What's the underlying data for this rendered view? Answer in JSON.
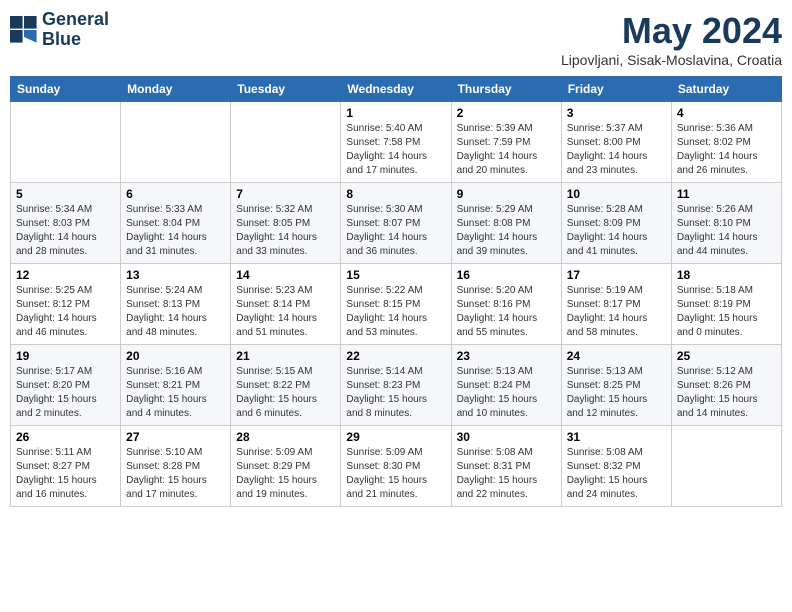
{
  "header": {
    "logo_line1": "General",
    "logo_line2": "Blue",
    "month_title": "May 2024",
    "location": "Lipovljani, Sisak-Moslavina, Croatia"
  },
  "days_of_week": [
    "Sunday",
    "Monday",
    "Tuesday",
    "Wednesday",
    "Thursday",
    "Friday",
    "Saturday"
  ],
  "weeks": [
    [
      {
        "day": "",
        "info": ""
      },
      {
        "day": "",
        "info": ""
      },
      {
        "day": "",
        "info": ""
      },
      {
        "day": "1",
        "info": "Sunrise: 5:40 AM\nSunset: 7:58 PM\nDaylight: 14 hours\nand 17 minutes."
      },
      {
        "day": "2",
        "info": "Sunrise: 5:39 AM\nSunset: 7:59 PM\nDaylight: 14 hours\nand 20 minutes."
      },
      {
        "day": "3",
        "info": "Sunrise: 5:37 AM\nSunset: 8:00 PM\nDaylight: 14 hours\nand 23 minutes."
      },
      {
        "day": "4",
        "info": "Sunrise: 5:36 AM\nSunset: 8:02 PM\nDaylight: 14 hours\nand 26 minutes."
      }
    ],
    [
      {
        "day": "5",
        "info": "Sunrise: 5:34 AM\nSunset: 8:03 PM\nDaylight: 14 hours\nand 28 minutes."
      },
      {
        "day": "6",
        "info": "Sunrise: 5:33 AM\nSunset: 8:04 PM\nDaylight: 14 hours\nand 31 minutes."
      },
      {
        "day": "7",
        "info": "Sunrise: 5:32 AM\nSunset: 8:05 PM\nDaylight: 14 hours\nand 33 minutes."
      },
      {
        "day": "8",
        "info": "Sunrise: 5:30 AM\nSunset: 8:07 PM\nDaylight: 14 hours\nand 36 minutes."
      },
      {
        "day": "9",
        "info": "Sunrise: 5:29 AM\nSunset: 8:08 PM\nDaylight: 14 hours\nand 39 minutes."
      },
      {
        "day": "10",
        "info": "Sunrise: 5:28 AM\nSunset: 8:09 PM\nDaylight: 14 hours\nand 41 minutes."
      },
      {
        "day": "11",
        "info": "Sunrise: 5:26 AM\nSunset: 8:10 PM\nDaylight: 14 hours\nand 44 minutes."
      }
    ],
    [
      {
        "day": "12",
        "info": "Sunrise: 5:25 AM\nSunset: 8:12 PM\nDaylight: 14 hours\nand 46 minutes."
      },
      {
        "day": "13",
        "info": "Sunrise: 5:24 AM\nSunset: 8:13 PM\nDaylight: 14 hours\nand 48 minutes."
      },
      {
        "day": "14",
        "info": "Sunrise: 5:23 AM\nSunset: 8:14 PM\nDaylight: 14 hours\nand 51 minutes."
      },
      {
        "day": "15",
        "info": "Sunrise: 5:22 AM\nSunset: 8:15 PM\nDaylight: 14 hours\nand 53 minutes."
      },
      {
        "day": "16",
        "info": "Sunrise: 5:20 AM\nSunset: 8:16 PM\nDaylight: 14 hours\nand 55 minutes."
      },
      {
        "day": "17",
        "info": "Sunrise: 5:19 AM\nSunset: 8:17 PM\nDaylight: 14 hours\nand 58 minutes."
      },
      {
        "day": "18",
        "info": "Sunrise: 5:18 AM\nSunset: 8:19 PM\nDaylight: 15 hours\nand 0 minutes."
      }
    ],
    [
      {
        "day": "19",
        "info": "Sunrise: 5:17 AM\nSunset: 8:20 PM\nDaylight: 15 hours\nand 2 minutes."
      },
      {
        "day": "20",
        "info": "Sunrise: 5:16 AM\nSunset: 8:21 PM\nDaylight: 15 hours\nand 4 minutes."
      },
      {
        "day": "21",
        "info": "Sunrise: 5:15 AM\nSunset: 8:22 PM\nDaylight: 15 hours\nand 6 minutes."
      },
      {
        "day": "22",
        "info": "Sunrise: 5:14 AM\nSunset: 8:23 PM\nDaylight: 15 hours\nand 8 minutes."
      },
      {
        "day": "23",
        "info": "Sunrise: 5:13 AM\nSunset: 8:24 PM\nDaylight: 15 hours\nand 10 minutes."
      },
      {
        "day": "24",
        "info": "Sunrise: 5:13 AM\nSunset: 8:25 PM\nDaylight: 15 hours\nand 12 minutes."
      },
      {
        "day": "25",
        "info": "Sunrise: 5:12 AM\nSunset: 8:26 PM\nDaylight: 15 hours\nand 14 minutes."
      }
    ],
    [
      {
        "day": "26",
        "info": "Sunrise: 5:11 AM\nSunset: 8:27 PM\nDaylight: 15 hours\nand 16 minutes."
      },
      {
        "day": "27",
        "info": "Sunrise: 5:10 AM\nSunset: 8:28 PM\nDaylight: 15 hours\nand 17 minutes."
      },
      {
        "day": "28",
        "info": "Sunrise: 5:09 AM\nSunset: 8:29 PM\nDaylight: 15 hours\nand 19 minutes."
      },
      {
        "day": "29",
        "info": "Sunrise: 5:09 AM\nSunset: 8:30 PM\nDaylight: 15 hours\nand 21 minutes."
      },
      {
        "day": "30",
        "info": "Sunrise: 5:08 AM\nSunset: 8:31 PM\nDaylight: 15 hours\nand 22 minutes."
      },
      {
        "day": "31",
        "info": "Sunrise: 5:08 AM\nSunset: 8:32 PM\nDaylight: 15 hours\nand 24 minutes."
      },
      {
        "day": "",
        "info": ""
      }
    ]
  ]
}
